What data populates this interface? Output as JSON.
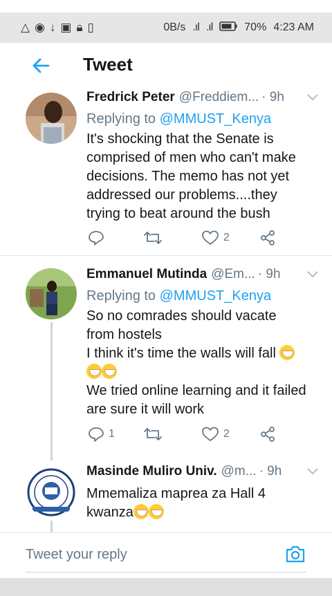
{
  "status_bar": {
    "network_speed": "0B/s",
    "network_type": "3G",
    "battery": "70%",
    "time": "4:23 AM",
    "icons": [
      "warning-icon",
      "vpn-icon",
      "download-icon",
      "screenshot-icon",
      "lock-icon",
      "battery-saver-icon"
    ]
  },
  "header": {
    "title": "Tweet",
    "back_icon": "back-arrow-icon",
    "accent": "#1da1f2"
  },
  "tweets": [
    {
      "name": "Fredrick Peter",
      "handle": "@Freddiem...",
      "time": "· 9h",
      "replying_prefix": "Replying to ",
      "replying_to": "@MMUST_Kenya",
      "text": "It's shocking that the Senate is\ncomprised of men who can't make\ndecisions. The memo has not yet\naddressed our problems....they\ntrying to beat around the bush",
      "reply_count": "",
      "retweet_count": "",
      "like_count": "2"
    },
    {
      "name": "Emmanuel Mutinda",
      "handle": "@Em...",
      "time": "· 9h",
      "replying_prefix": "Replying to ",
      "replying_to": "@MMUST_Kenya",
      "text_line1": "So no comrades should vacate\nfrom hostels\nI think it's time the walls will fall ",
      "text_line2": "We tried online learning and it failed\nare sure it will work",
      "reply_count": "1",
      "retweet_count": "",
      "like_count": "2"
    },
    {
      "name": "Masinde Muliro Univ.",
      "handle": "@m...",
      "time": "· 9h",
      "text": "Mmemaliza maprea za Hall 4\nkwanza"
    }
  ],
  "reply_bar": {
    "placeholder": "Tweet your reply",
    "camera_icon": "camera-icon"
  },
  "colors": {
    "link": "#1da1f2",
    "secondary_text": "#657786",
    "divider": "#e1e8ed"
  }
}
